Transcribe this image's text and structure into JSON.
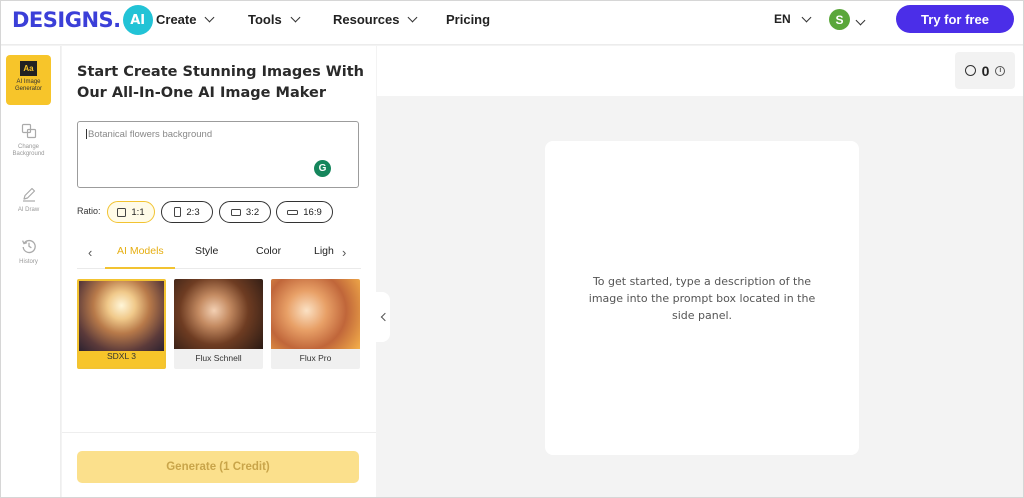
{
  "header": {
    "logo": "DESIGNS.",
    "logo_badge": "AI",
    "nav": [
      {
        "label": "Create"
      },
      {
        "label": "Tools"
      },
      {
        "label": "Resources"
      },
      {
        "label": "Pricing"
      }
    ],
    "language": "EN",
    "avatar_initial": "S",
    "cta": "Try for free"
  },
  "rail": {
    "items": [
      {
        "label": "AI Image Generator",
        "icon": "text-aa-icon",
        "active": true
      },
      {
        "label": "Change Background",
        "icon": "layers-icon"
      },
      {
        "label": "AI Draw",
        "icon": "pen-icon"
      },
      {
        "label": "History",
        "icon": "history-icon"
      }
    ]
  },
  "panel": {
    "title": "Start Create Stunning Images With Our All-In-One AI Image Maker",
    "prompt_placeholder": "Botanical flowers background",
    "ratio_label": "Ratio:",
    "ratios": [
      "1:1",
      "2:3",
      "3:2",
      "16:9"
    ],
    "tabs": [
      "AI Models",
      "Style",
      "Color",
      "Ligh"
    ],
    "models": [
      {
        "label": "SDXL 3"
      },
      {
        "label": "Flux Schnell"
      },
      {
        "label": "Flux Pro"
      }
    ],
    "generate_label": "Generate (1 Credit)"
  },
  "main": {
    "credits": "0",
    "empty_message": "To get started, type a description of the image into the prompt box located in the side panel."
  },
  "colors": {
    "accent_yellow": "#f7c52a",
    "cta_purple": "#4b2ee8",
    "logo_blue": "#3b3fd8"
  }
}
